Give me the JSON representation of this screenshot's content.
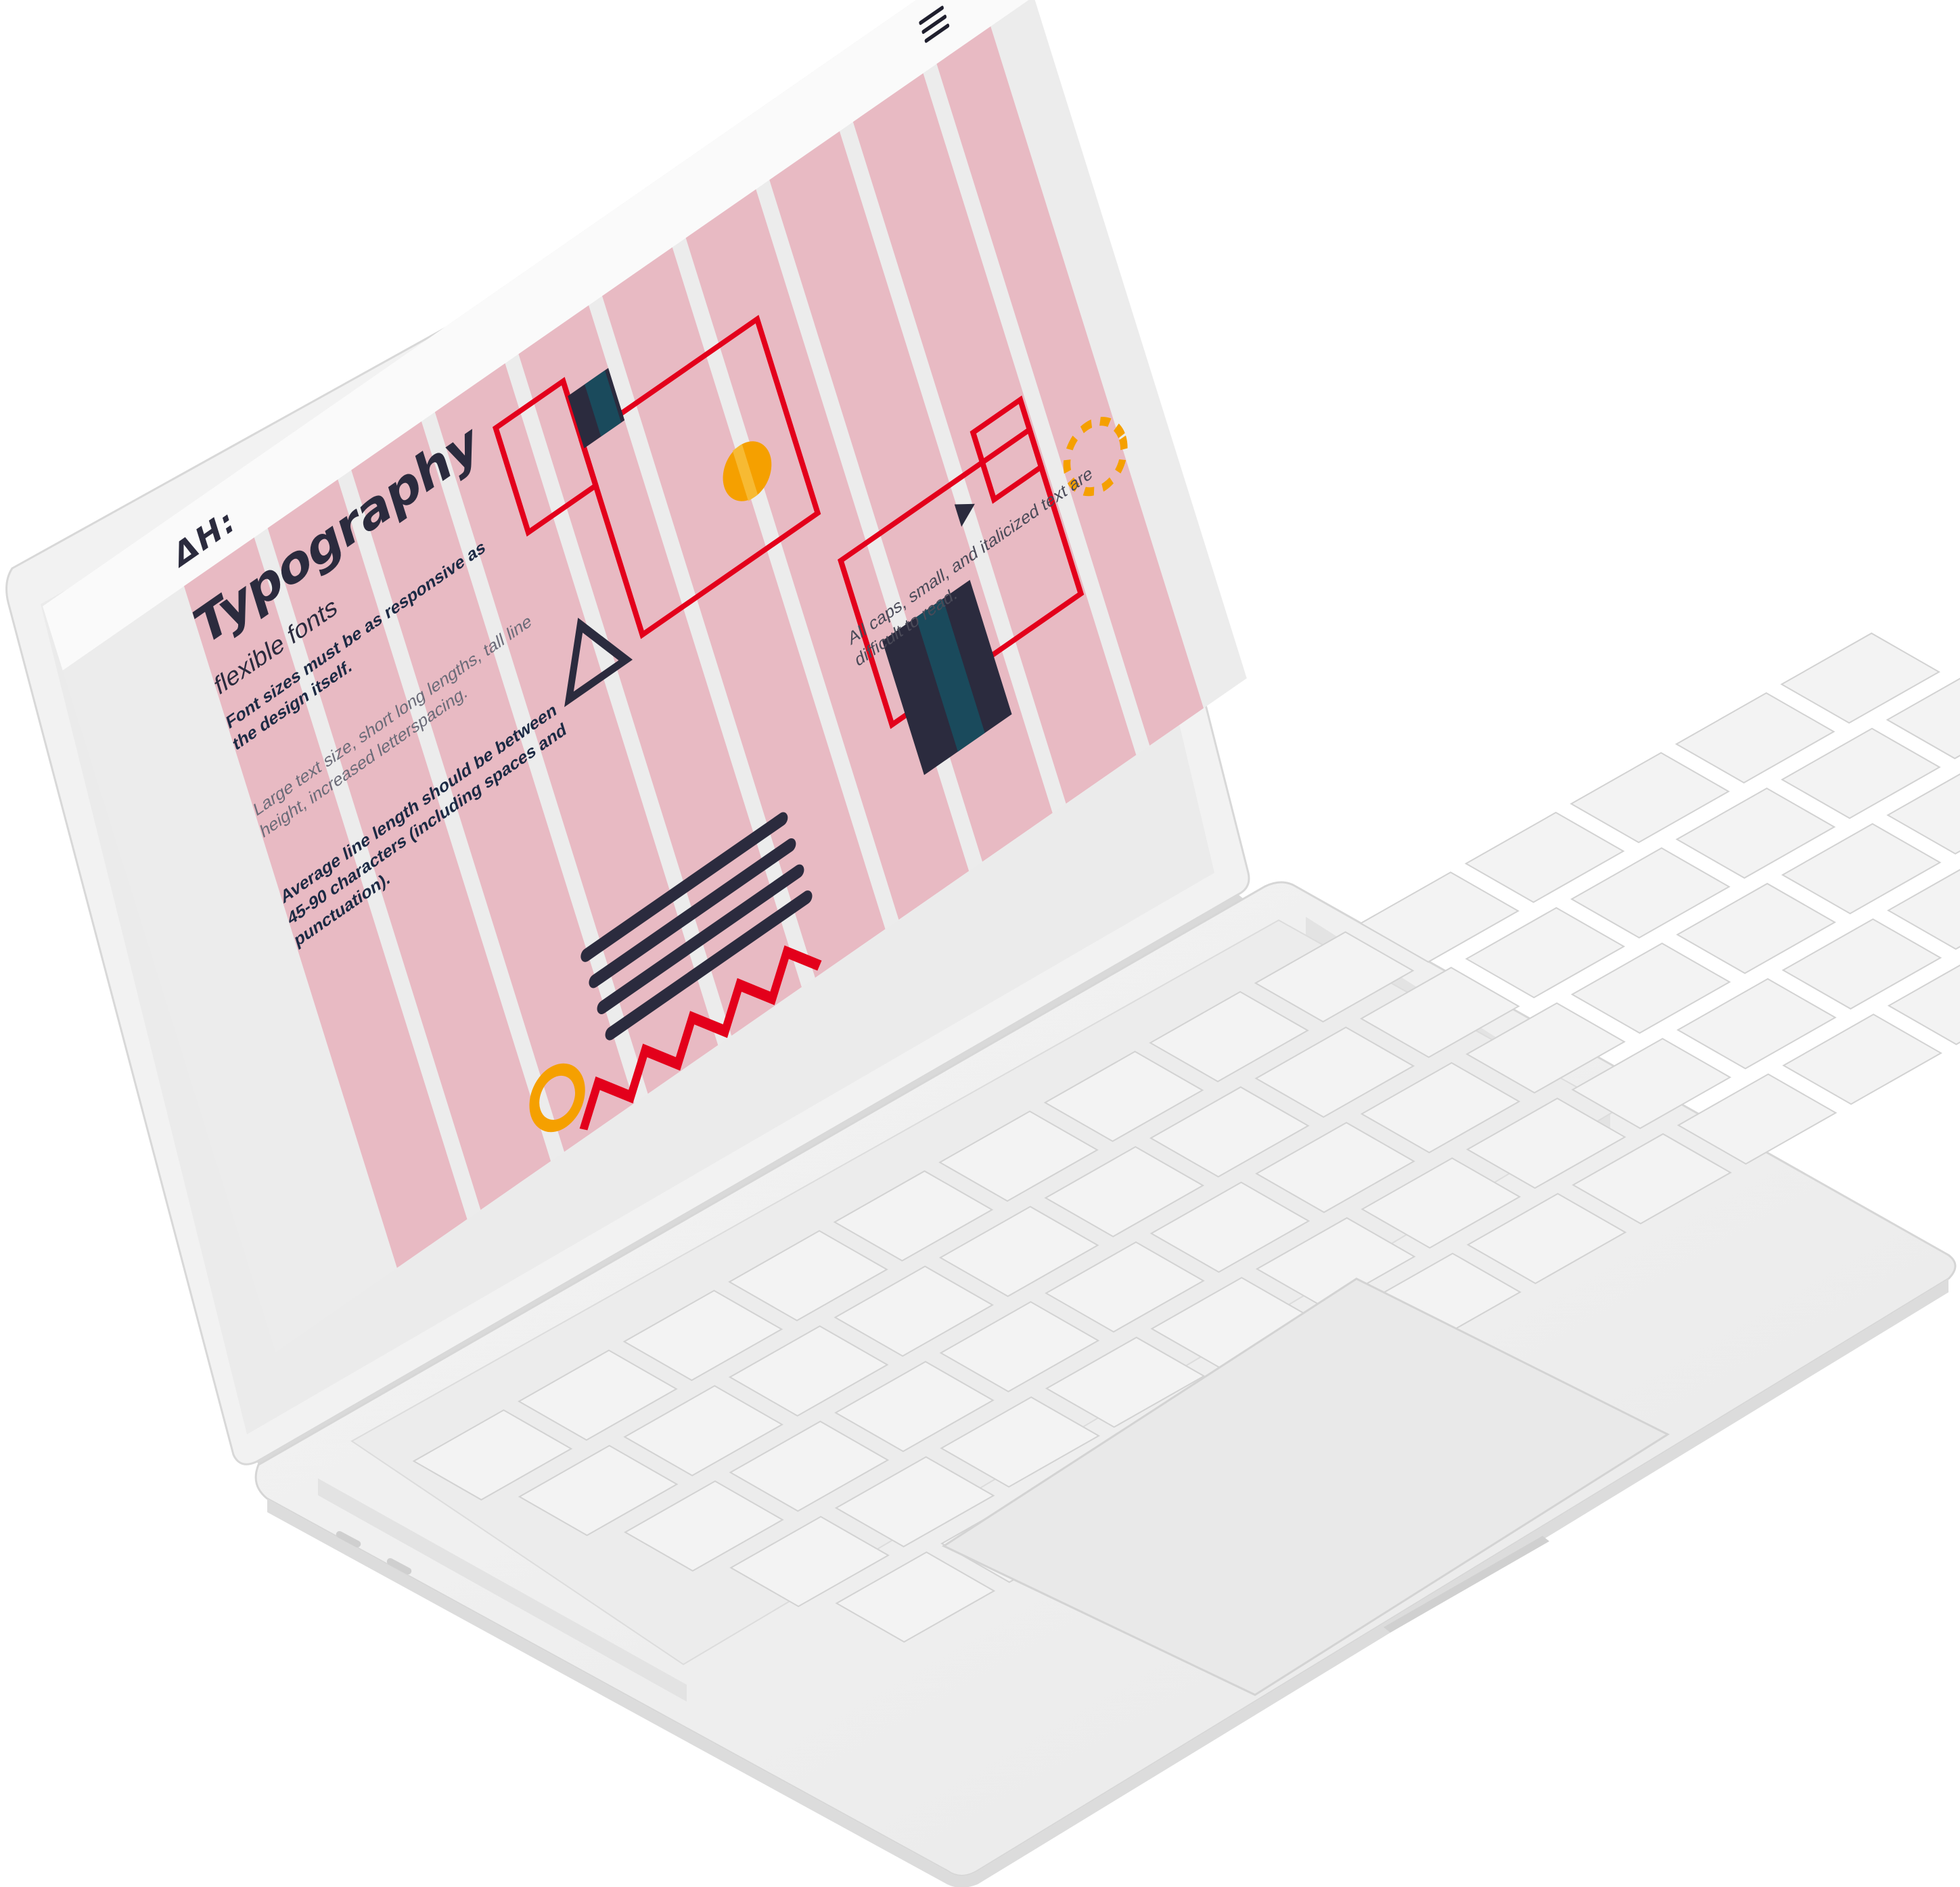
{
  "app": {
    "logo_text": "ΔΗ:",
    "menu_icon": "hamburger-menu-icon"
  },
  "hero": {
    "title": "Typography",
    "subtitle": "flexible fonts",
    "statement": "Font sizes must be as responsive as the design itself.",
    "tips_light": "Large text size, short long lengths, tall line height, increased letterspacing.",
    "tips_bold": "Average line length should be between 45-90 characters (including spaces and punctuation).",
    "caption": "All caps, small, and italicized text are difficult to read."
  },
  "colors": {
    "background": "#ececec",
    "column": "#e8bac3",
    "accent_red": "#e3001b",
    "accent_orange": "#f5a000",
    "navy": "#2b2b3e",
    "teal": "#1a4a5c"
  }
}
